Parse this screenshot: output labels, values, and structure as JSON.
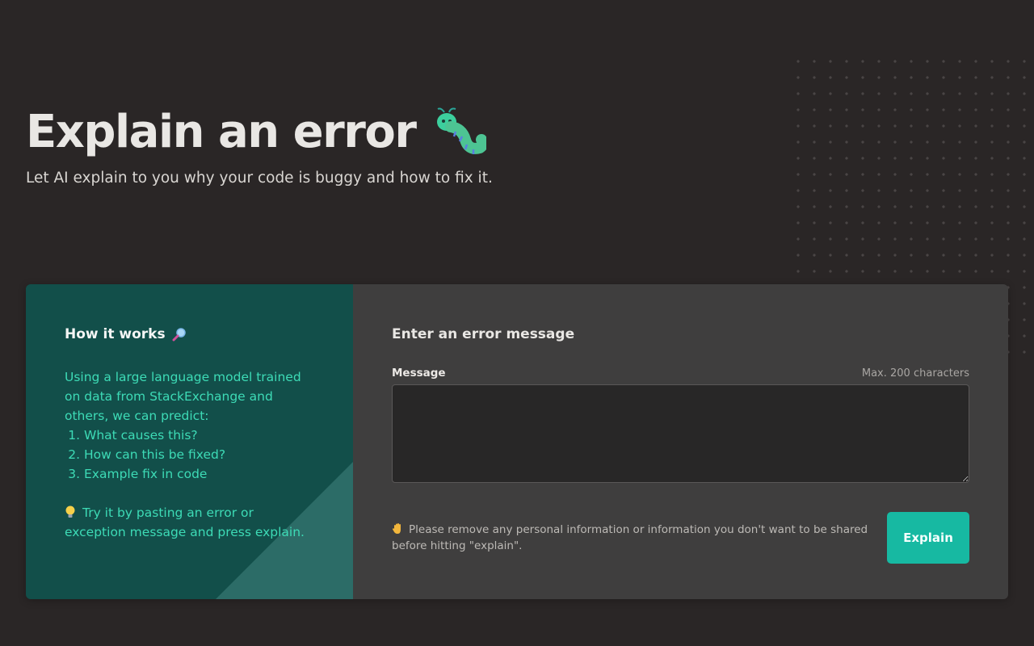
{
  "hero": {
    "title": "Explain an error",
    "title_icon": "caterpillar-icon",
    "subtitle": "Let AI explain to you why your code is buggy and how to fix it."
  },
  "how_it_works": {
    "title": "How it works",
    "title_icon": "magnifier-icon",
    "intro": "Using a large language model trained on data from StackExchange and others, we can predict:",
    "steps": [
      "What causes this?",
      "How can this be fixed?",
      "Example fix in code"
    ],
    "tip_icon": "lightbulb-icon",
    "tip": "Try it by pasting an error or exception message and press explain."
  },
  "form": {
    "title": "Enter an error message",
    "message_label": "Message",
    "message_hint": "Max. 200 characters",
    "message_value": "",
    "notice_icon": "raised-hand-icon",
    "notice": "Please remove any personal information or information you don't want to be shared before hitting \"explain\".",
    "submit_label": "Explain"
  },
  "colors": {
    "background": "#2a2626",
    "left_panel": "#124f4a",
    "left_text": "#3ddbb6",
    "right_panel": "#3f3e3e",
    "button": "#17b9a2"
  }
}
